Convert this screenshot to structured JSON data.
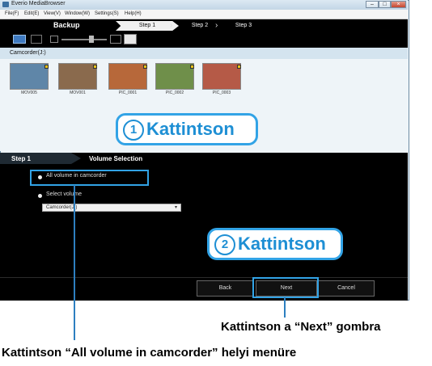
{
  "window": {
    "title": "Everio MediaBrowser",
    "menu": [
      "File(F)",
      "Edit(E)",
      "View(V)",
      "Window(W)",
      "Settings(S)",
      "Help(H)"
    ]
  },
  "header": {
    "backup_title": "Backup",
    "steps": [
      "Step 1",
      "Step 2",
      "Step 3"
    ]
  },
  "content": {
    "drive_label": "Camcorder(J:)",
    "thumbnails": [
      {
        "name": "MOV005",
        "color": "#5f86a8"
      },
      {
        "name": "MOV001",
        "color": "#8a6a4d"
      },
      {
        "name": "PIC_0001",
        "color": "#b7683a"
      },
      {
        "name": "PIC_0002",
        "color": "#6f8f4a"
      },
      {
        "name": "PIC_0003",
        "color": "#b55a47"
      }
    ]
  },
  "step_panel": {
    "step_label": "Step 1",
    "section_title": "Volume Selection",
    "option_all": "All volume in camcorder",
    "option_select": "Select volume",
    "volume_value": "Camcorder(J:)"
  },
  "buttons": {
    "back": "Back",
    "next": "Next",
    "cancel": "Cancel"
  },
  "callouts": {
    "one_number": "1",
    "one_text": "Kattintson",
    "two_number": "2",
    "two_text": "Kattintson"
  },
  "captions": {
    "next": "Kattintson a “Next” gombra",
    "all": "Kattintson “All volume in camcorder” helyi menüre"
  },
  "colors": {
    "accent": "#32a3e6"
  }
}
